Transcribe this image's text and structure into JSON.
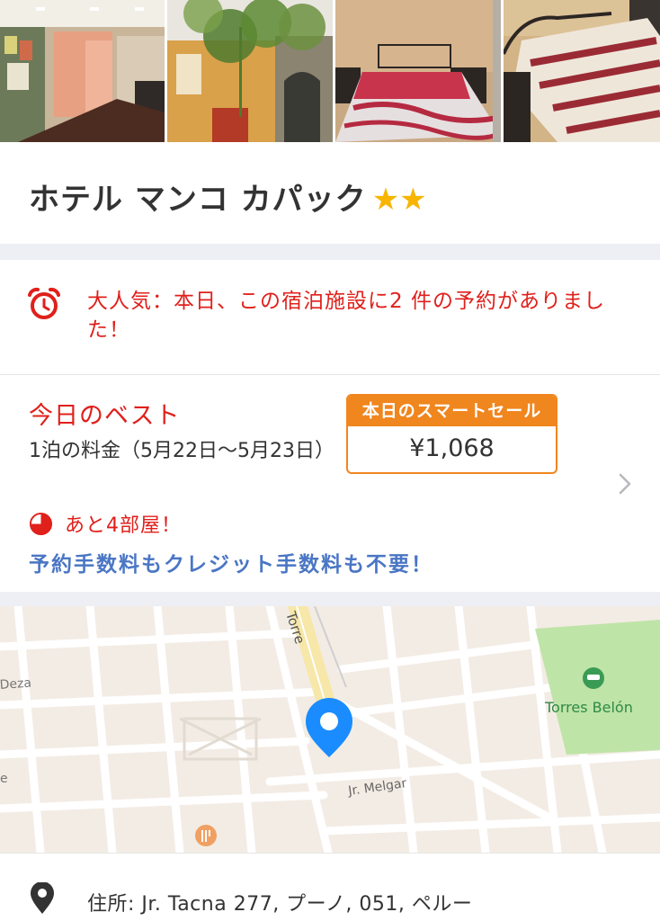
{
  "hotel": {
    "name": "ホテル マンコ カパック",
    "stars": "★★"
  },
  "photos": [
    {
      "name": "lobby-photo"
    },
    {
      "name": "exterior-photo"
    },
    {
      "name": "bedroom-photo-1"
    },
    {
      "name": "bedroom-photo-2"
    }
  ],
  "alert": {
    "icon": "alarm-clock-icon",
    "text": "大人気：本日、この宿泊施設に2 件の予約がありました！"
  },
  "deal": {
    "title": "今日のベスト",
    "price_desc": "1泊の料金（5月22日～5月23日）",
    "sale_label": "本日のスマートセール",
    "price": "¥1,068",
    "rooms_left": "あと4部屋！",
    "no_fee": "予約手数料もクレジット手数料も不要！"
  },
  "map": {
    "labels": {
      "torre": "Torre",
      "deza": "Deza",
      "melgar": "Jr. Melgar",
      "park": "Torres Belón",
      "edge_e": "e"
    }
  },
  "address": {
    "text": "住所: Jr. Tacna 277, プーノ, 051, ペルー"
  },
  "colors": {
    "accent_red": "#e0201b",
    "sale_orange": "#f0861e",
    "link_blue": "#4a76c4",
    "star_gold": "#f7b500",
    "pin_blue": "#1a8cff"
  }
}
